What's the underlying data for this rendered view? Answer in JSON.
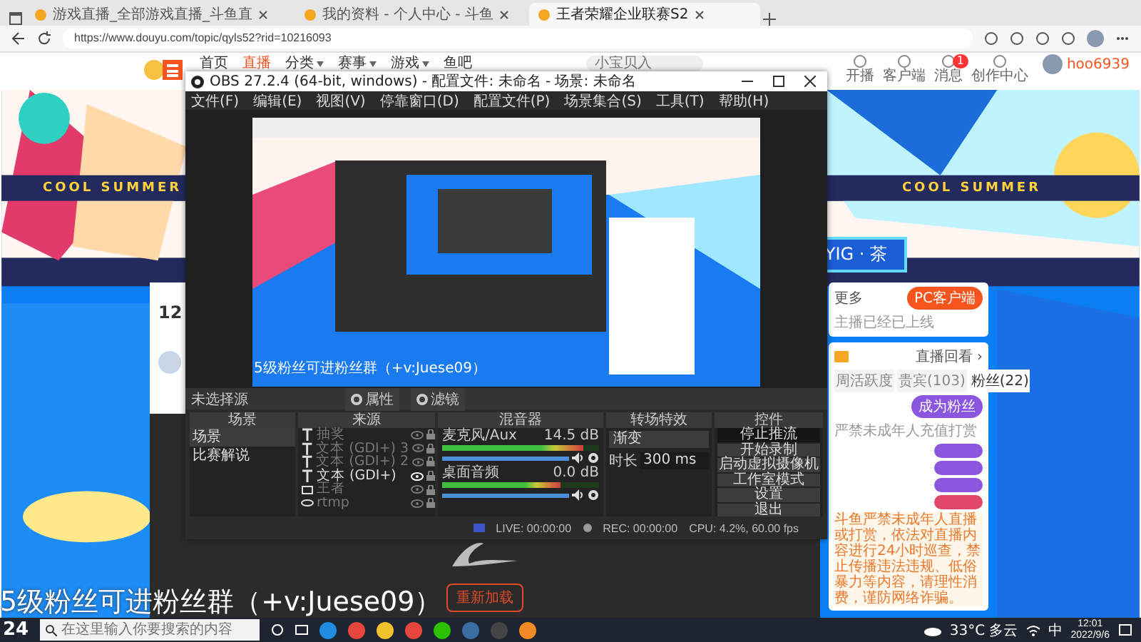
{
  "browser": {
    "tabs": [
      {
        "label": "游戏直播_全部游戏直播_斗鱼直",
        "selected": false
      },
      {
        "label": "我的资料 - 个人中心 - 斗鱼",
        "selected": false
      },
      {
        "label": "王者荣耀企业联赛S2",
        "selected": true
      }
    ],
    "url": "https://www.douyu.com/topic/qyls52?rid=10216093"
  },
  "site": {
    "nav": [
      {
        "label": "首页",
        "selected": false,
        "dropdown": false
      },
      {
        "label": "直播",
        "selected": true,
        "dropdown": false
      },
      {
        "label": "分类",
        "selected": false,
        "dropdown": true
      },
      {
        "label": "赛事",
        "selected": false,
        "dropdown": true
      },
      {
        "label": "游戏",
        "selected": false,
        "dropdown": true
      },
      {
        "label": "鱼吧",
        "selected": false,
        "dropdown": false
      }
    ],
    "search_placeholder": "小宝贝入",
    "links": [
      {
        "label": "开播"
      },
      {
        "label": "客户端"
      },
      {
        "label": "消息",
        "badge": "1"
      },
      {
        "label": "创作中心"
      }
    ],
    "username": "hoo6939"
  },
  "banner": {
    "slogans": [
      "COOL SUMMER",
      "COOL SUMMER"
    ],
    "title": "YIG · 茶"
  },
  "room": {
    "count": "12",
    "more": "更多",
    "client_button": "PC客户端",
    "client_note": "主播已经已上线",
    "replay": "直播回看 ›",
    "rank_tabs": [
      {
        "label": "周活跃度",
        "selected": false
      },
      {
        "label": "贵宾(103)",
        "selected": false
      },
      {
        "label": "粉丝(22)",
        "selected": true
      }
    ],
    "fan_button": "成为粉丝",
    "hint": "严禁未成年人充值打赏",
    "fan_badges": [
      {
        "color": "#8b55e0"
      },
      {
        "color": "#8b55e0"
      },
      {
        "color": "#8b55e0"
      },
      {
        "color": "#e0466a"
      }
    ],
    "notice": "斗鱼严禁未成年人直播或打赏，依法对直播内容进行24小时巡查，禁止传播违法违规、低俗暴力等内容，请理性消费，谨防网络诈骗。"
  },
  "player": {
    "reload_button": "重新加载"
  },
  "obs": {
    "title": "OBS 27.2.4 (64-bit, windows) - 配置文件: 未命名 - 场景: 未命名",
    "menu": [
      "文件(F)",
      "编辑(E)",
      "视图(V)",
      "停靠窗口(D)",
      "配置文件(P)",
      "场景集合(S)",
      "工具(T)",
      "帮助(H)"
    ],
    "preview_caption": "5级粉丝可进粉丝群（+v:Juese09）",
    "no_source": "未选择源",
    "source_buttons": [
      "属性",
      "滤镜"
    ],
    "scenes": {
      "title": "场景",
      "items": [
        {
          "label": "场景",
          "selected": true
        },
        {
          "label": "比赛解说",
          "selected": false
        }
      ]
    },
    "sources": {
      "title": "来源",
      "items": [
        {
          "label": "抽奖",
          "kind": "text",
          "visible": false
        },
        {
          "label": "文本 (GDI+) 3",
          "kind": "text",
          "visible": false
        },
        {
          "label": "文本 (GDI+) 2",
          "kind": "text",
          "visible": false
        },
        {
          "label": "文本 (GDI+)",
          "kind": "text",
          "visible": true
        },
        {
          "label": "王者",
          "kind": "display",
          "visible": false
        },
        {
          "label": "rtmp",
          "kind": "media",
          "visible": false
        }
      ]
    },
    "mixer": {
      "title": "混音器",
      "channels": [
        {
          "name": "麦克风/Aux",
          "reading": "14.5 dB",
          "meter": {
            "level": 0.9
          },
          "volume": {
            "level": 1
          }
        },
        {
          "name": "桌面音频",
          "reading": "0.0 dB",
          "meter": {
            "level": 0.75
          },
          "volume": {
            "level": 1
          }
        }
      ]
    },
    "transitions": {
      "title": "转场特效",
      "type": "渐变",
      "duration_label": "时长",
      "duration": "300 ms"
    },
    "controls": {
      "title": "控件",
      "buttons": [
        {
          "label": "停止推流",
          "active": true
        },
        {
          "label": "开始录制",
          "active": false
        },
        {
          "label": "启动虚拟摄像机",
          "active": false
        },
        {
          "label": "工作室模式",
          "active": false
        },
        {
          "label": "设置",
          "active": false
        },
        {
          "label": "退出",
          "active": false
        }
      ]
    },
    "status": {
      "live": "LIVE: 00:00:00",
      "rec": "REC: 00:00:00",
      "cpu": "CPU: 4.2%, 60.00 fps"
    }
  },
  "caption": "5级粉丝可进粉丝群（+v:Juese09）",
  "taskbar": {
    "day": "24",
    "search_placeholder": "在这里输入你要搜索的内容",
    "weather": "33°C 多云",
    "ime": "中",
    "time": "12:01",
    "date": "2022/9/6"
  }
}
